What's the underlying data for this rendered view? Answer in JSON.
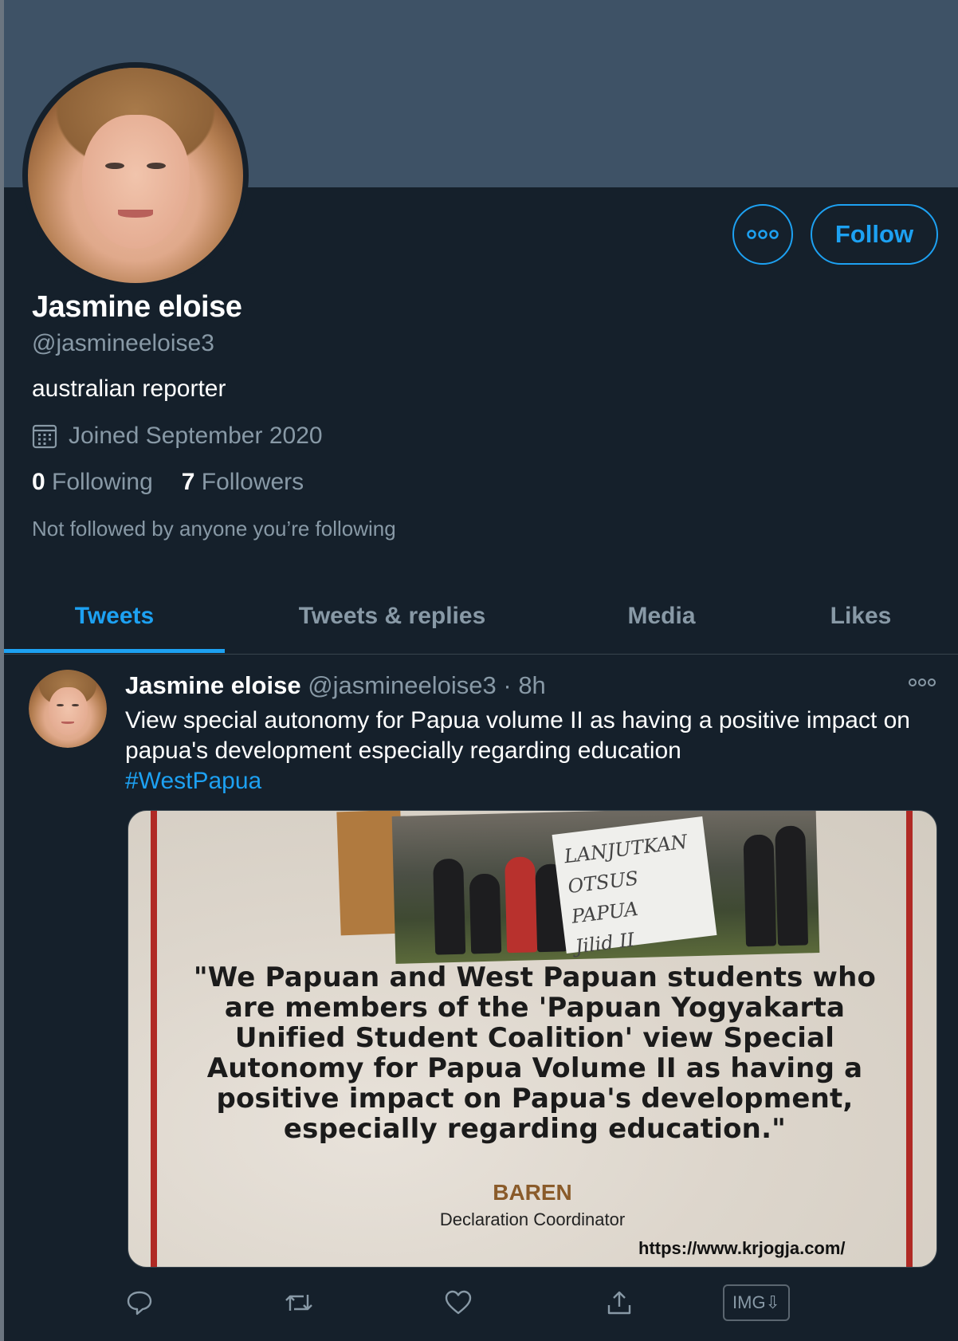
{
  "profile": {
    "name": "Jasmine eloise",
    "handle": "@jasmineeloise3",
    "bio": "australian reporter",
    "joined": "Joined September 2020",
    "following_count": "0",
    "following_label": "Following",
    "followers_count": "7",
    "followers_label": "Followers",
    "not_followed": "Not followed by anyone you’re following"
  },
  "buttons": {
    "more_icon": "more-icon",
    "follow_label": "Follow"
  },
  "tabs": [
    {
      "label": "Tweets",
      "active": true
    },
    {
      "label": "Tweets & replies",
      "active": false
    },
    {
      "label": "Media",
      "active": false
    },
    {
      "label": "Likes",
      "active": false
    }
  ],
  "tweet": {
    "author_name": "Jasmine eloise",
    "author_handle": "@jasmineeloise3",
    "separator": "·",
    "time": "8h",
    "text": "View special autonomy for Papua volume II as having a positive impact on papua's development especially regarding education",
    "hashtag": "#WestPapua",
    "media": {
      "banner_lines": [
        "LANJUTKAN",
        "OTSUS PAPUA",
        "Jilid II"
      ],
      "quote": "\"We Papuan and West Papuan students who are members of the 'Papuan Yogyakarta Unified Student Coalition' view Special Autonomy for Papua Volume II as having a positive impact on Papua's development, especially regarding education.\"",
      "name": "BAREN",
      "role": "Declaration Coordinator",
      "url": "https://www.krjogja.com/"
    },
    "actions": {
      "reply_icon": "reply-icon",
      "retweet_icon": "retweet-icon",
      "like_icon": "heart-icon",
      "share_icon": "share-icon",
      "img_label": "IMG⇩"
    }
  },
  "colors": {
    "background": "#15202b",
    "banner": "#3e5266",
    "accent": "#1da1f2",
    "secondary_text": "#8899a6"
  }
}
